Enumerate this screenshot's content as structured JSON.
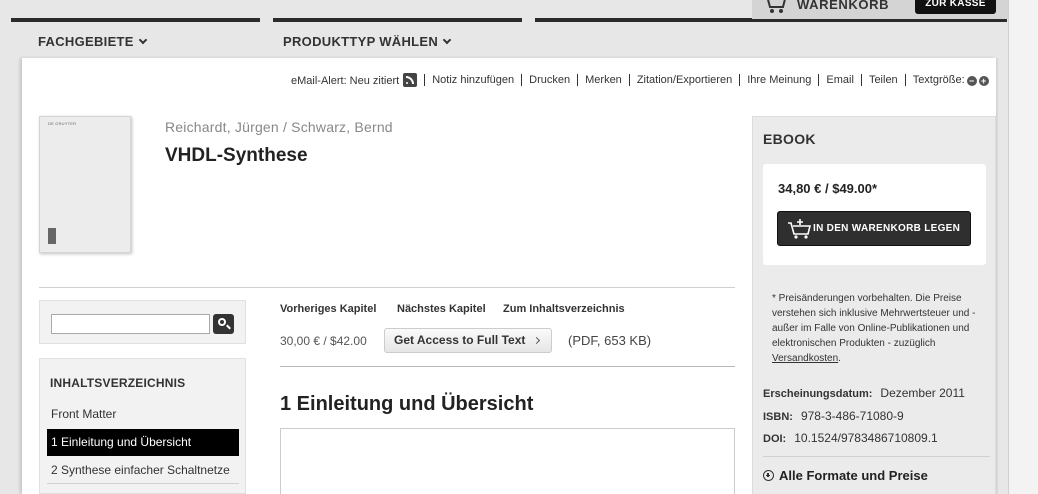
{
  "header": {
    "cart_label": "WARENKORB",
    "checkout_label": "ZUR KASSE",
    "nav": [
      {
        "label": "FACHGEBIETE"
      },
      {
        "label": "PRODUKTTYP WÄHLEN"
      }
    ]
  },
  "toolbar": {
    "email_alert": "eMail-Alert: Neu zitiert",
    "items": [
      "Notiz hinzufügen",
      "Drucken",
      "Merken",
      "Zitation/Exportieren",
      "Ihre Meinung",
      "Email",
      "Teilen"
    ],
    "text_size_label": "Textgröße:",
    "decrease": "−",
    "increase": "+"
  },
  "book": {
    "cover_publisher": "DE GRUYTER",
    "authors": "Reichardt, Jürgen / Schwarz, Bernd",
    "title": "VHDL-Synthese"
  },
  "search": {
    "placeholder": ""
  },
  "toc": {
    "title": "INHALTSVERZEICHNIS",
    "items": [
      {
        "label": "Front Matter"
      },
      {
        "label": "1 Einleitung und Übersicht"
      },
      {
        "label": "2 Synthese einfacher Schaltnetze"
      }
    ]
  },
  "chapter": {
    "prev": "Vorheriges Kapitel",
    "next": "Nächstes Kapitel",
    "toc_link": "Zum Inhaltsverzeichnis",
    "price": "30,00 € / $42.00",
    "access_button": "Get Access to Full Text",
    "pdf_info": "(PDF, 653 KB)",
    "heading": "1 Einleitung und Übersicht"
  },
  "sidebar": {
    "title": "EBOOK",
    "price": "34,80 € / $49.00*",
    "add_to_cart": "IN DEN WARENKORB LEGEN",
    "footnote": "* Preisänderungen vorbehalten. Die Preise verstehen sich inklusive Mehrwertsteuer und - außer im Falle von Online-Publikationen und elektronischen Produkten - zuzüglich",
    "footnote_link": "Versandkosten",
    "footnote_end": ".",
    "meta": {
      "date_label": "Erscheinungsdatum:",
      "date_value": "Dezember 2011",
      "isbn_label": "ISBN:",
      "isbn_value": "978-3-486-71080-9",
      "doi_label": "DOI:",
      "doi_value": "10.1524/9783486710809.1"
    },
    "all_formats": "Alle Formate und Preise"
  }
}
